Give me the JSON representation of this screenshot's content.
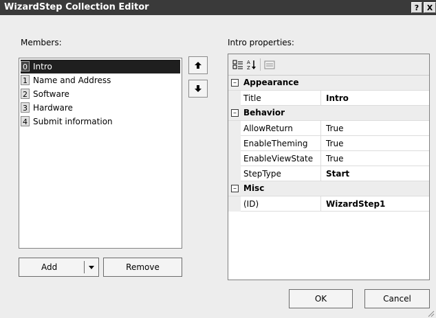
{
  "window": {
    "title": "WizardStep Collection Editor",
    "help_label": "?",
    "close_label": "X"
  },
  "members": {
    "label": "Members:",
    "items": [
      {
        "index": "0",
        "name": "Intro"
      },
      {
        "index": "1",
        "name": "Name and Address"
      },
      {
        "index": "2",
        "name": "Software"
      },
      {
        "index": "3",
        "name": "Hardware"
      },
      {
        "index": "4",
        "name": "Submit information"
      }
    ],
    "move_up_icon": "arrow-up-icon",
    "move_down_icon": "arrow-down-icon",
    "add_label": "Add",
    "remove_label": "Remove"
  },
  "properties": {
    "label": "Intro properties:",
    "categories": [
      {
        "name": "Appearance",
        "props": [
          {
            "name": "Title",
            "value": "Intro",
            "bold": true
          }
        ]
      },
      {
        "name": "Behavior",
        "props": [
          {
            "name": "AllowReturn",
            "value": "True",
            "bold": false
          },
          {
            "name": "EnableTheming",
            "value": "True",
            "bold": false
          },
          {
            "name": "EnableViewState",
            "value": "True",
            "bold": false
          },
          {
            "name": "StepType",
            "value": "Start",
            "bold": true
          }
        ]
      },
      {
        "name": "Misc",
        "props": [
          {
            "name": "(ID)",
            "value": "WizardStep1",
            "bold": true
          }
        ]
      }
    ]
  },
  "footer": {
    "ok_label": "OK",
    "cancel_label": "Cancel"
  }
}
